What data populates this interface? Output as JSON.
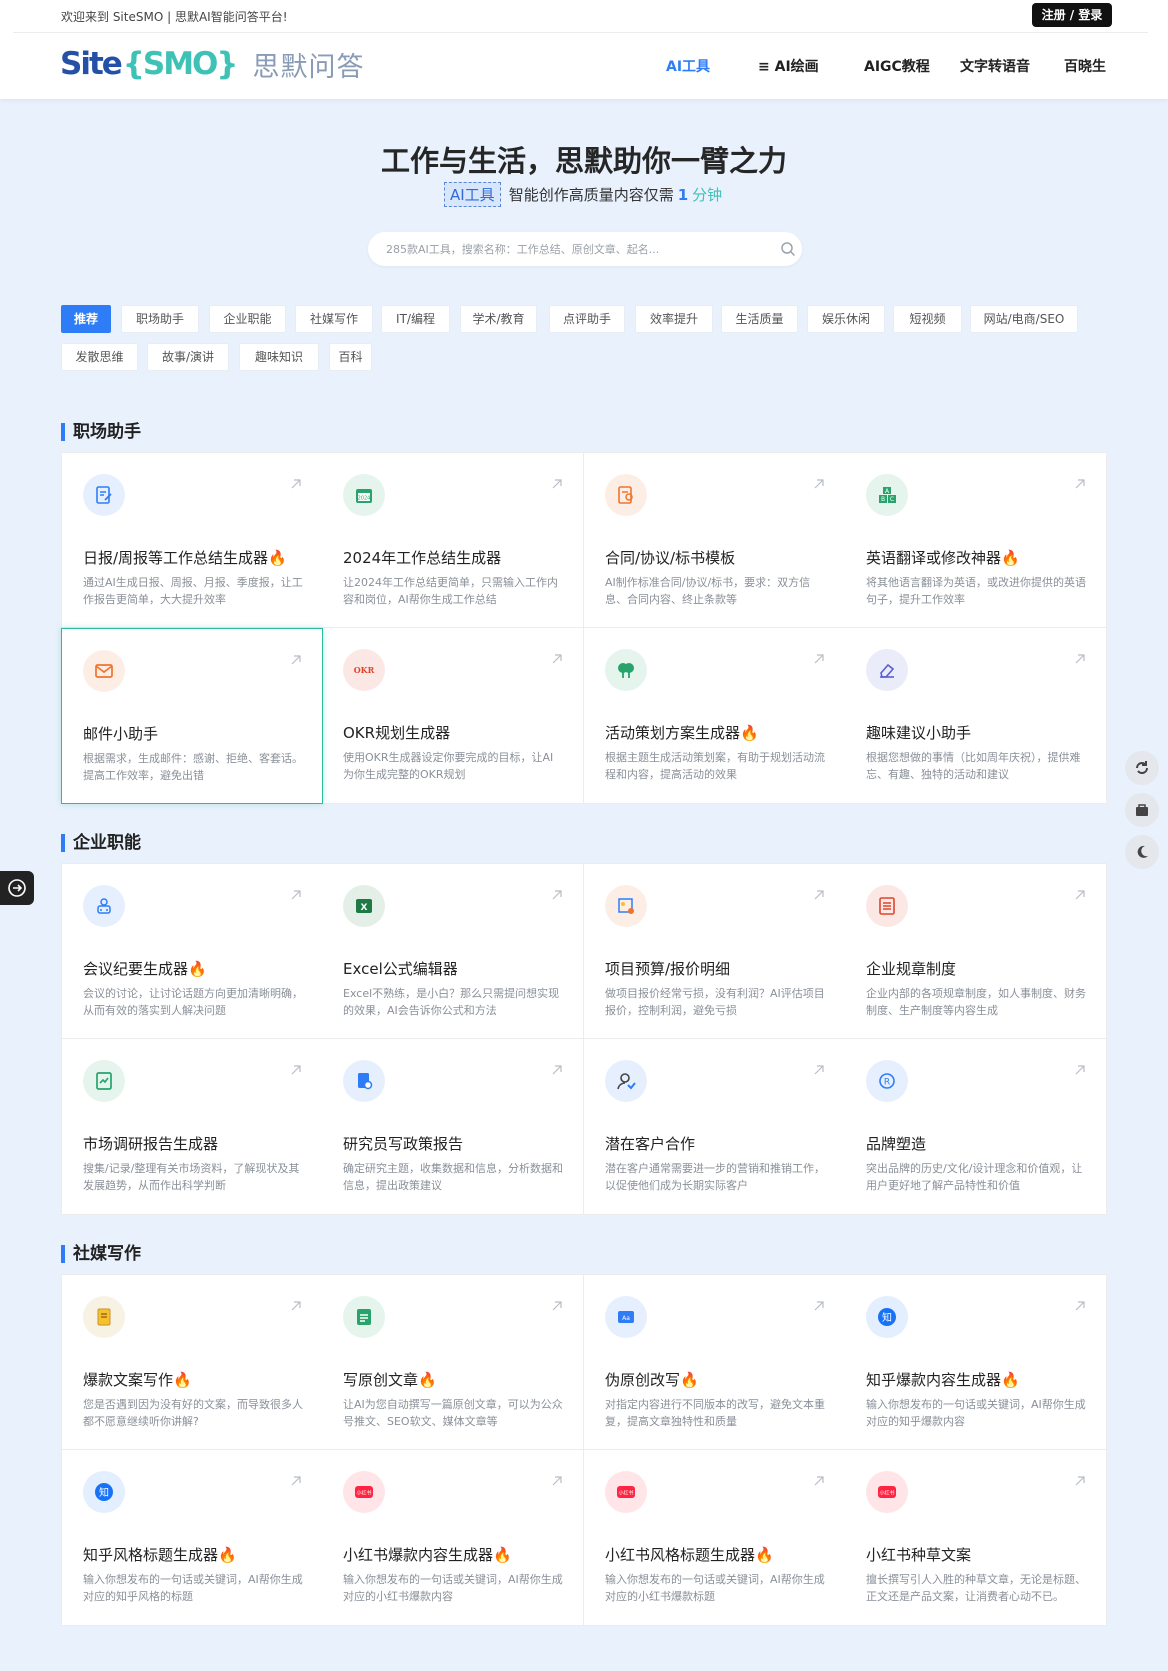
{
  "topbar": {
    "welcome": "欢迎来到 SiteSMO | 思默AI智能问答平台!",
    "login": "注册 / 登录"
  },
  "logo": {
    "site": "Site",
    "smo": "{SMO}",
    "cn": "思默问答"
  },
  "nav": [
    {
      "label": "AI工具",
      "active": true
    },
    {
      "label": "≡ AI绘画",
      "active": false
    },
    {
      "label": "AIGC教程",
      "active": false
    },
    {
      "label": "文字转语音",
      "active": false
    },
    {
      "label": "百晓生",
      "active": false
    }
  ],
  "hero": {
    "title": "工作与生活，思默助你一臂之力",
    "tag": "AI工具",
    "sub": "智能创作高质量内容仅需",
    "num": "1",
    "unit": "分钟"
  },
  "search": {
    "placeholder": "285款AI工具，搜索名称：工作总结、原创文章、起名..."
  },
  "categories": [
    "推荐",
    "职场助手",
    "企业职能",
    "社媒写作",
    "IT/编程",
    "学术/教育",
    "点评助手",
    "效率提升",
    "生活质量",
    "娱乐休闲",
    "短视频",
    "网站/电商/SEO",
    "发散思维",
    "故事/演讲",
    "趣味知识",
    "百科"
  ],
  "sections": [
    {
      "title": "职场助手",
      "cards": [
        {
          "title": "日报/周报等工作总结生成器",
          "hot": true,
          "desc": "通过AI生成日报、周报、月报、季度报，让工作报告更简单，大大提升效率",
          "icon": "edit-doc-icon",
          "color": "#2f7df6"
        },
        {
          "title": "2024年工作总结生成器",
          "hot": false,
          "desc": "让2024年工作总结更简单，只需输入工作内容和岗位，AI帮你生成工作总结",
          "icon": "calendar-icon",
          "color": "#27a36b"
        },
        {
          "title": "合同/协议/标书模板",
          "hot": false,
          "desc": "AI制作标准合同/协议/标书，要求：双方信息、合同内容、终止条款等",
          "icon": "contract-icon",
          "color": "#f0742b"
        },
        {
          "title": "英语翻译或修改神器",
          "hot": true,
          "desc": "将其他语言翻译为英语，或改进你提供的英语句子，提升工作效率",
          "icon": "abc-blocks-icon",
          "color": "#27a36b"
        },
        {
          "title": "邮件小助手",
          "hot": false,
          "desc": "根据需求，生成邮件：感谢、拒绝、客套话。提高工作效率，避免出错",
          "icon": "mail-icon",
          "color": "#f0742b"
        },
        {
          "title": "OKR规划生成器",
          "hot": false,
          "desc": "使用OKR生成器设定你要完成的目标，让AI为你生成完整的OKR规划",
          "icon": "okr-icon",
          "color": "#e0452b"
        },
        {
          "title": "活动策划方案生成器",
          "hot": true,
          "desc": "根据主题生成活动策划案，有助于规划活动流程和内容，提高活动的效果",
          "icon": "tree-icon",
          "color": "#27a36b"
        },
        {
          "title": "趣味建议小助手",
          "hot": false,
          "desc": "根据您想做的事情（比如周年庆祝），提供难忘、有趣、独特的活动和建议",
          "icon": "eraser-icon",
          "color": "#5a5fd6"
        }
      ]
    },
    {
      "title": "企业职能",
      "cards": [
        {
          "title": "会议纪要生成器",
          "hot": true,
          "desc": "会议的讨论，让讨论话题方向更加清晰明确，从而有效的落实到人解决问题",
          "icon": "meeting-icon",
          "color": "#2f7df6"
        },
        {
          "title": "Excel公式编辑器",
          "hot": false,
          "desc": "Excel不熟练，是小白？那么只需提问想实现的效果，AI会告诉你公式和方法",
          "icon": "excel-icon",
          "color": "#1e7a45"
        },
        {
          "title": "项目预算/报价明细",
          "hot": false,
          "desc": "做项目报价经常亏损，没有利润？AI评估项目报价，控制利润，避免亏损",
          "icon": "budget-icon",
          "color": "#f0742b"
        },
        {
          "title": "企业规章制度",
          "hot": false,
          "desc": "企业内部的各项规章制度，如人事制度、财务制度、生产制度等内容生成",
          "icon": "checklist-icon",
          "color": "#e0452b"
        },
        {
          "title": "市场调研报告生成器",
          "hot": false,
          "desc": "搜集/记录/整理有关市场资料，了解现状及其发展趋势，从而作出科学判断",
          "icon": "report-icon",
          "color": "#27a36b"
        },
        {
          "title": "研究员写政策报告",
          "hot": false,
          "desc": "确定研究主题，收集数据和信息，分析数据和信息，提出政策建议",
          "icon": "research-icon",
          "color": "#2f7df6"
        },
        {
          "title": "潜在客户合作",
          "hot": false,
          "desc": "潜在客户通常需要进一步的营销和推销工作，以促使他们成为长期实际客户",
          "icon": "customer-icon",
          "color": "#2f7df6"
        },
        {
          "title": "品牌塑造",
          "hot": false,
          "desc": "突出品牌的历史/文化/设计理念和价值观，让用户更好地了解产品特性和价值",
          "icon": "brand-icon",
          "color": "#2f7df6"
        }
      ]
    },
    {
      "title": "社媒写作",
      "cards": [
        {
          "title": "爆款文案写作",
          "hot": true,
          "desc": "您是否遇到因为没有好的文案，而导致很多人都不愿意继续听你讲解?",
          "icon": "note-icon",
          "color": "#c9922b"
        },
        {
          "title": "写原创文章",
          "hot": true,
          "desc": "让AI为您自动撰写一篇原创文章，可以为公众号推文、SEO软文、媒体文章等",
          "icon": "doc-green-icon",
          "color": "#27a36b"
        },
        {
          "title": "伪原创改写",
          "hot": true,
          "desc": "对指定内容进行不同版本的改写，避免文本重复，提高文章独特性和质量",
          "icon": "rewrite-icon",
          "color": "#2f7df6"
        },
        {
          "title": "知乎爆款内容生成器",
          "hot": true,
          "desc": "输入你想发布的一句话或关键词，AI帮你生成对应的知乎爆款内容",
          "icon": "zhihu-icon",
          "color": "#1772f6"
        },
        {
          "title": "知乎风格标题生成器",
          "hot": true,
          "desc": "输入你想发布的一句话或关键词，AI帮你生成对应的知乎风格的标题",
          "icon": "zhihu-icon",
          "color": "#1772f6"
        },
        {
          "title": "小红书爆款内容生成器",
          "hot": true,
          "desc": "输入你想发布的一句话或关键词，AI帮你生成对应的小红书爆款内容",
          "icon": "xiaohongshu-icon",
          "color": "#ff2442"
        },
        {
          "title": "小红书风格标题生成器",
          "hot": true,
          "desc": "输入你想发布的一句话或关键词，AI帮你生成对应的小红书爆款标题",
          "icon": "xiaohongshu-icon",
          "color": "#ff2442"
        },
        {
          "title": "小红书种草文案",
          "hot": false,
          "desc": "擅长撰写引人入胜的种草文章，无论是标题、正文还是产品文案，让消费者心动不已。",
          "icon": "xiaohongshu-icon",
          "color": "#ff2442"
        }
      ]
    }
  ],
  "float_buttons": [
    "refresh-icon",
    "bag-icon",
    "moon-icon"
  ],
  "side_tab": "login-arrow-icon"
}
